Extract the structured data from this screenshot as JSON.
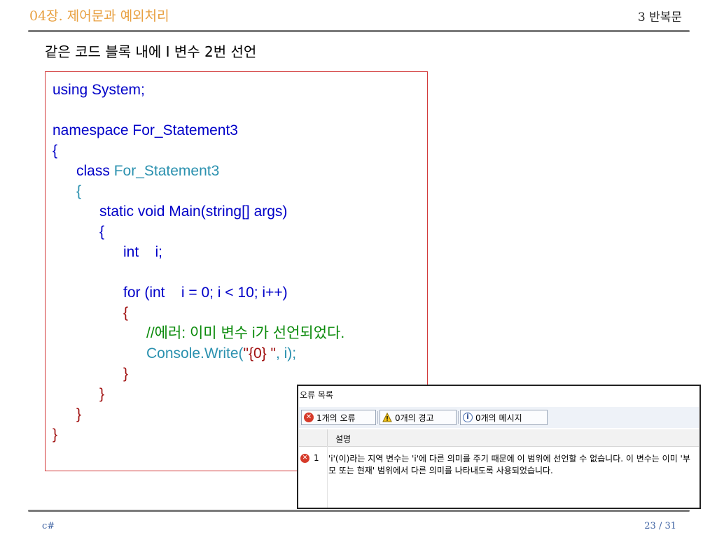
{
  "header": {
    "chapter": "04장. 제어문과 예외처리",
    "section": "3 반복문"
  },
  "slide_title": "같은 코드 블록 내에 I 변수 2번 선언",
  "code": {
    "l1": "using System;",
    "l3": "namespace For_Statement3",
    "l4": "{",
    "l5a": "class ",
    "l5b": "For_Statement3",
    "l6": "{",
    "l7": "static void Main(string[] args)",
    "l8": "{",
    "l9": "int    i;",
    "l11": "for (int    i = 0; i < 10; i++)",
    "l12": "{",
    "l13": "//에러: 이미 변수 i가 선언되었다.",
    "l14a": "Console.Write(",
    "l14b": "\"{0} \"",
    "l14c": ", i);",
    "l15": "}",
    "l16": "}",
    "l17": "}",
    "l18": "}"
  },
  "error_panel": {
    "title": "오류 목록",
    "tabs": {
      "errors": "1개의 오류",
      "warnings": "0개의 경고",
      "messages": "0개의 메시지"
    },
    "column_description": "설명",
    "row": {
      "number": "1",
      "description": "'i'(이)라는 지역 변수는 'i'에 다른 의미를 주기 때문에 이 범위에 선언할 수 없습니다. 이 변수는 이미 '부모 또는 현재' 범위에서 다른 의미를 나타내도록 사용되었습니다."
    }
  },
  "footer": {
    "left": "c#",
    "page": "23 / 31"
  }
}
